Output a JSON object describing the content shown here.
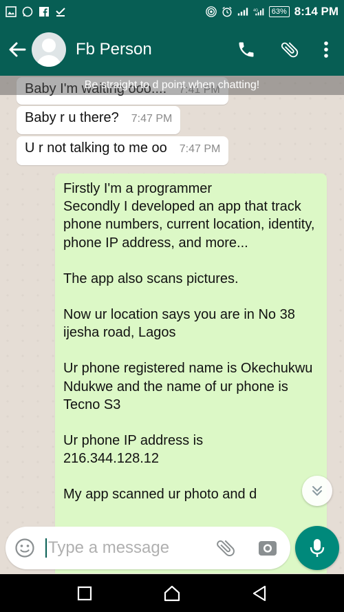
{
  "status": {
    "battery": "63%",
    "time": "8:14 PM",
    "network": "4G"
  },
  "header": {
    "contact_name": "Fb Person",
    "icons": [
      "back-arrow-icon",
      "avatar",
      "phone-icon",
      "attach-icon",
      "more-vert-icon"
    ]
  },
  "chat": {
    "tip": "Be straight to d point when chatting!",
    "incoming": [
      {
        "text": "Baby I'm waiting ooo....",
        "time": "7:41 PM"
      },
      {
        "text": "Baby r u there?",
        "time": "7:47 PM"
      },
      {
        "text": "U r not talking to me oo",
        "time": "7:47 PM"
      }
    ],
    "outgoing": {
      "paragraphs": [
        "Firstly I'm a programmer\nSecondly I developed an app that track phone numbers, current location, identity, phone IP address, and more...",
        "The app also scans pictures.",
        "Now ur location says you are in No 38 ijesha road, Lagos",
        "Ur phone registered name is Okechukwu Ndukwe and the name of ur phone is Tecno S3",
        "Ur phone IP address is 216.344.128.12",
        "My app scanned ur photo and d"
      ]
    }
  },
  "input": {
    "placeholder": "Type a message"
  },
  "colors": {
    "header": "#075e54",
    "outgoing_bubble": "#dcf8c6",
    "mic": "#00897b"
  }
}
